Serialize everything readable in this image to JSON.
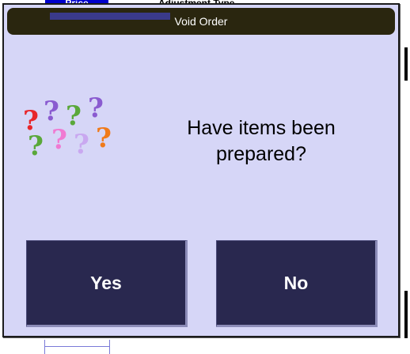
{
  "background": {
    "header_price": "Price",
    "header_adjustment": "Adjustment Type"
  },
  "dialog": {
    "title": "Void Order",
    "message": "Have items been\nprepared?",
    "icon": "question-marks-icon",
    "buttons": {
      "yes_label": "Yes",
      "no_label": "No"
    }
  },
  "colors": {
    "dialog_bg": "#d6d6f7",
    "title_bar": "#2a260f",
    "button_bg": "#29284f",
    "qm_red": "#e8262a",
    "qm_purple": "#8a5bd0",
    "qm_green": "#5aa83a",
    "qm_pink": "#f07ad2",
    "qm_orange": "#f07a1a",
    "qm_lavender": "#c9a8f0"
  }
}
